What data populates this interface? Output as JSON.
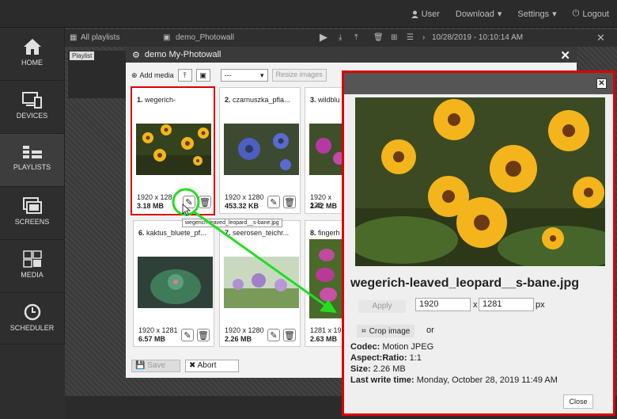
{
  "topnav": {
    "user": "User",
    "download": "Download",
    "settings": "Settings",
    "logout": "Logout"
  },
  "sidebar": [
    {
      "label": "HOME",
      "icon": "home-icon"
    },
    {
      "label": "DEVICES",
      "icon": "devices-icon"
    },
    {
      "label": "PLAYLISTS",
      "icon": "playlists-icon",
      "active": true
    },
    {
      "label": "SCREENS",
      "icon": "screens-icon"
    },
    {
      "label": "MEDIA",
      "icon": "media-icon"
    },
    {
      "label": "SCHEDULER",
      "icon": "scheduler-icon"
    }
  ],
  "playlist_bar": {
    "all_playlists": "All playlists",
    "name": "demo_Photowall",
    "datetime": "10/28/2019 - 10:10:14 AM",
    "tag": "Playlist"
  },
  "dialog": {
    "title": "demo My-Photowall",
    "add_media": "Add media",
    "select_value": "---",
    "resize_label": "Resize images",
    "save_label": "Save",
    "abort_label": "Abort"
  },
  "cards": [
    {
      "num": "1.",
      "name": "wegerich-",
      "dim": "1920 x 128",
      "size": "3.18 MB"
    },
    {
      "num": "2.",
      "name": "czarnuszka_pfla...",
      "dim": "1920 x 1280",
      "size": "453.32 KB"
    },
    {
      "num": "3.",
      "name": "wildblu",
      "dim": "1920 x 128",
      "size": "2.42 MB"
    },
    {
      "num": "6.",
      "name": "kaktus_bluete_pf...",
      "dim": "1920 x 1281",
      "size": "6.57 MB"
    },
    {
      "num": "7.",
      "name": "seerosen_teichr...",
      "dim": "1920 x 1280",
      "size": "2.26 MB"
    },
    {
      "num": "8.",
      "name": "fingerh",
      "dim": "1281 x 19",
      "size": "2.63 MB"
    }
  ],
  "tooltip": "wegerich-leaved_leopard__s-bane.jpg",
  "detail": {
    "filename": "wegerich-leaved_leopard__s-bane.jpg",
    "apply": "Apply",
    "width": "1920",
    "x": "x",
    "height": "1281",
    "px": "px",
    "crop": "Crop image",
    "or": "or",
    "codec_label": "Codec:",
    "codec": "Motion JPEG",
    "ratio_label": "Aspect:Ratio:",
    "ratio": "1:1",
    "size_label": "Size:",
    "size": "2.26 MB",
    "lwt_label": "Last write time:",
    "lwt": "Monday, October 28, 2019 11:49 AM",
    "close": "Close"
  },
  "colors": {
    "highlight_red": "#dd0000",
    "arrow_green": "#22dd22"
  }
}
